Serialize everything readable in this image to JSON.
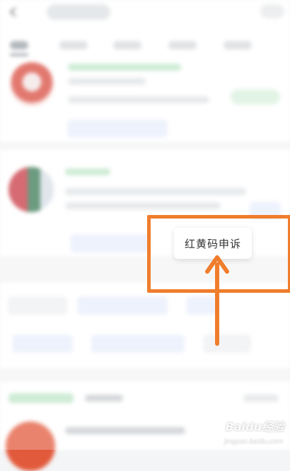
{
  "popup_menu": {
    "items": [
      {
        "label": "红黄码申诉"
      }
    ]
  },
  "highlight": {
    "color": "#f07d2c"
  },
  "watermark": {
    "brand": "Baidu经验",
    "url": "jingyan.baidu.com"
  },
  "colors": {
    "accent_green": "#4caf50",
    "card_bg": "#ffffff",
    "page_bg": "#f4f5f6"
  },
  "icons": {
    "back": "back-arrow-icon",
    "pointer": "arrow-up-icon"
  }
}
